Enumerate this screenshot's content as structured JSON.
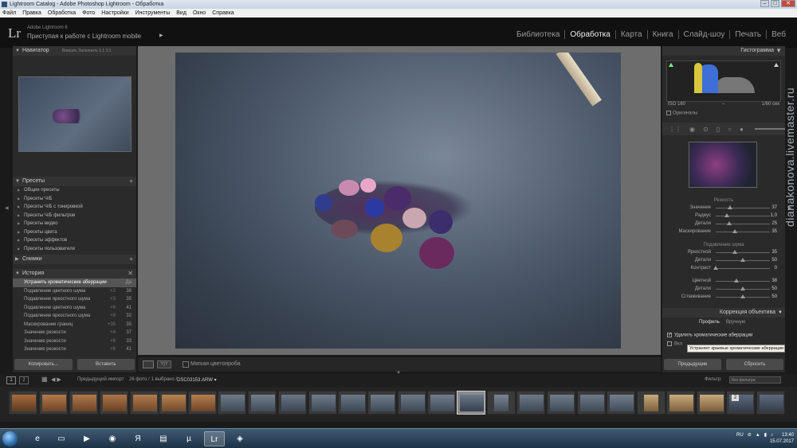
{
  "window": {
    "title": "Lightroom Catalog - Adobe Photoshop Lightroom - Обработка",
    "buttons": [
      "–",
      "□",
      "✕"
    ]
  },
  "menu": [
    "Файл",
    "Правка",
    "Обработка",
    "Фото",
    "Настройки",
    "Инструменты",
    "Вид",
    "Окно",
    "Справка"
  ],
  "header": {
    "logo": "Lr",
    "product": "Adobe Lightroom 6",
    "tagline": "Приступая к работе с Lightroom mobile",
    "arrow": "▶",
    "modules": [
      "Библиотека",
      "Обработка",
      "Карта",
      "Книга",
      "Слайд-шоу",
      "Печать",
      "Веб"
    ],
    "active_module": "Обработка"
  },
  "navigator": {
    "title": "Навигатор",
    "options": "Вписать   Заполнить   1:1   3:1"
  },
  "presets": {
    "title": "Пресеты",
    "items": [
      "Общие пресеты",
      "Пресеты Ч/Б",
      "Пресеты Ч/Б с тонировкой",
      "Пресеты Ч/Б фильтров",
      "Пресеты видео",
      "Пресеты цвета",
      "Пресеты эффектов",
      "Пресеты пользователя"
    ]
  },
  "snapshots": {
    "title": "Снимки"
  },
  "history": {
    "title": "История",
    "items": [
      {
        "label": "Устранить хроматические аберрации",
        "v1": "",
        "v2": "Да"
      },
      {
        "label": "Подавление цветного шума",
        "v1": "+2",
        "v2": "38"
      },
      {
        "label": "Подавление яркостного шума",
        "v1": "+3",
        "v2": "35"
      },
      {
        "label": "Подавление цветного шума",
        "v1": "+6",
        "v2": "41"
      },
      {
        "label": "Подавление яркостного шума",
        "v1": "+8",
        "v2": "32"
      },
      {
        "label": "Маскирование границ",
        "v1": "+35",
        "v2": "35"
      },
      {
        "label": "Значение резкости",
        "v1": "+4",
        "v2": "37"
      },
      {
        "label": "Значение резкости",
        "v1": "+6",
        "v2": "33"
      },
      {
        "label": "Значение резкости",
        "v1": "+6",
        "v2": "41"
      }
    ]
  },
  "left_buttons": {
    "copy": "Копировать...",
    "paste": "Вставить"
  },
  "toolbar": {
    "view": "Y|Y",
    "softproof": "Мягкая цветопроба"
  },
  "histogram": {
    "title": "Гистограмма",
    "iso": "ISO 160",
    "dash": "–",
    "shutter": "1/60 сек",
    "original": "Оригиналы"
  },
  "sharpening": {
    "title": "Резкость",
    "rows": [
      {
        "label": "Значение",
        "value": "37",
        "level": 0.26
      },
      {
        "label": "Радиус",
        "value": "1,0",
        "level": 0.2
      },
      {
        "label": "Детали",
        "value": "25",
        "level": 0.25
      },
      {
        "label": "Маскирование",
        "value": "35",
        "level": 0.35
      }
    ]
  },
  "noise": {
    "title": "Подавление шума",
    "rows": [
      {
        "label": "Яркостной",
        "value": "35",
        "level": 0.35
      },
      {
        "label": "Детали",
        "value": "50",
        "level": 0.5
      },
      {
        "label": "Контраст",
        "value": "0",
        "level": 0.0
      },
      {
        "label": "Цветной",
        "value": "38",
        "level": 0.38
      },
      {
        "label": "Детали",
        "value": "50",
        "level": 0.5
      },
      {
        "label": "Сглаживание",
        "value": "50",
        "level": 0.5
      }
    ]
  },
  "lens": {
    "title": "Коррекция объектива",
    "tab_profile": "Профиль",
    "tab_manual": "Вручную",
    "chk1": "Удалить хроматические аберрации",
    "chk2": "Вкл",
    "tooltip": "Устраняет краевые хроматические аберрации"
  },
  "right_buttons": {
    "prev": "Предыдущие",
    "reset": "Сбросить"
  },
  "filmstrip_bar": {
    "b1": "1",
    "b2": "2",
    "prev": "Предыдущий импорт",
    "count": "26 фото / 1 выбрано /",
    "file": "DSC03153.ARW ▾",
    "filter": "Фильтр:",
    "filter_value": "Без фильтра"
  },
  "filmstrip_badge": "2",
  "taskbar": {
    "lang": "RU",
    "time": "13:40",
    "date": "15.07.2017"
  },
  "watermark": "dianakonova.livemaster.ru"
}
